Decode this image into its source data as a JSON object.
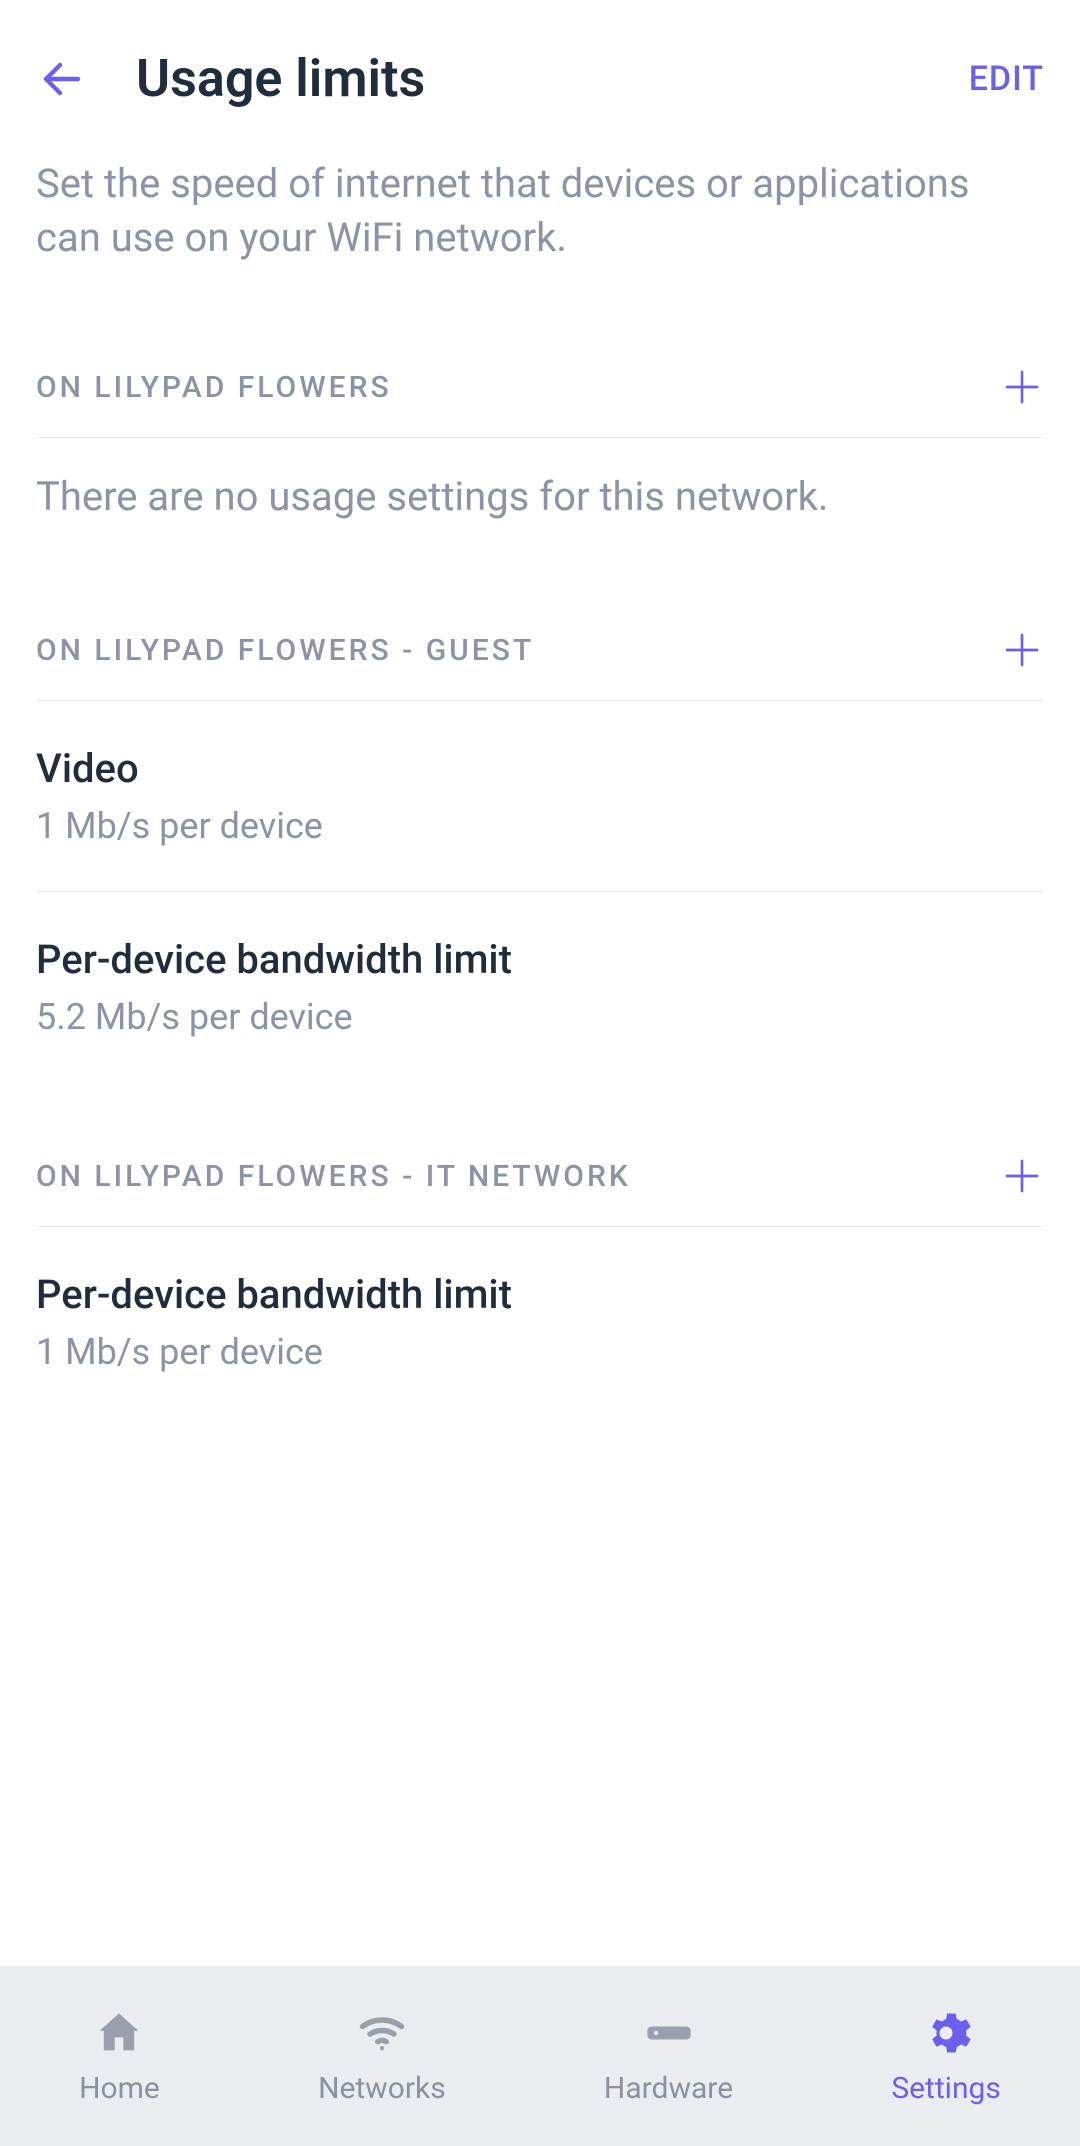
{
  "header": {
    "title": "Usage limits",
    "edit_label": "EDIT"
  },
  "subtitle": "Set the speed of internet that devices or applications can use on your WiFi network.",
  "sections": [
    {
      "label": "ON LILYPAD FLOWERS",
      "empty_message": "There are no usage settings for this network.",
      "limits": []
    },
    {
      "label": "ON LILYPAD FLOWERS - GUEST",
      "limits": [
        {
          "title": "Video",
          "value": "1 Mb/s per device"
        },
        {
          "title": "Per-device bandwidth limit",
          "value": "5.2 Mb/s per device"
        }
      ]
    },
    {
      "label": "ON LILYPAD FLOWERS - IT NETWORK",
      "limits": [
        {
          "title": "Per-device bandwidth limit",
          "value": "1 Mb/s per device"
        }
      ]
    }
  ],
  "bottomnav": {
    "items": [
      {
        "label": "Home",
        "icon": "home-icon",
        "active": false
      },
      {
        "label": "Networks",
        "icon": "wifi-icon",
        "active": false
      },
      {
        "label": "Hardware",
        "icon": "hardware-icon",
        "active": false
      },
      {
        "label": "Settings",
        "icon": "gear-icon",
        "active": true
      }
    ]
  }
}
